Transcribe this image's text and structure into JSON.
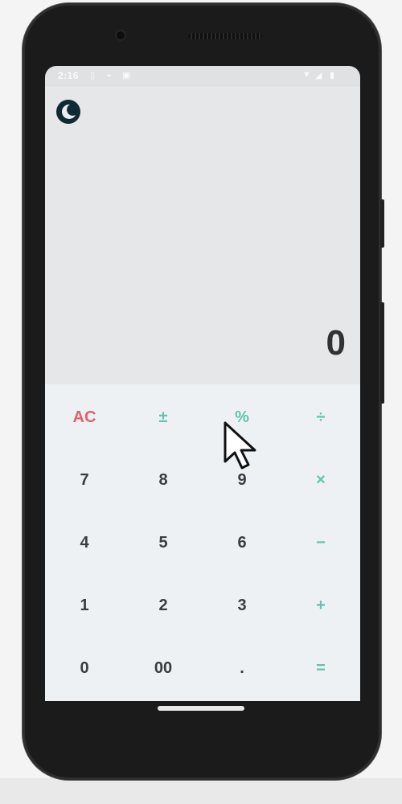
{
  "status_bar": {
    "time": "2:16",
    "icons": [
      "notification-icon",
      "notification-icon",
      "lock-icon",
      "wifi-icon",
      "signal-icon",
      "battery-icon"
    ]
  },
  "display": {
    "theme_toggle_icon": "moon-icon",
    "result": "0"
  },
  "keypad": {
    "rows": [
      [
        "AC",
        "±",
        "%",
        "÷"
      ],
      [
        "7",
        "8",
        "9",
        "×"
      ],
      [
        "4",
        "5",
        "6",
        "−"
      ],
      [
        "1",
        "2",
        "3",
        "+"
      ],
      [
        "0",
        "00",
        ".",
        "="
      ]
    ],
    "key_names": [
      [
        "all-clear-button",
        "plus-minus-button",
        "percent-button",
        "divide-button"
      ],
      [
        "digit-7-button",
        "digit-8-button",
        "digit-9-button",
        "multiply-button"
      ],
      [
        "digit-4-button",
        "digit-5-button",
        "digit-6-button",
        "minus-button"
      ],
      [
        "digit-1-button",
        "digit-2-button",
        "digit-3-button",
        "plus-button"
      ],
      [
        "digit-0-button",
        "double-zero-button",
        "decimal-button",
        "equals-button"
      ]
    ],
    "key_types": [
      [
        "clear",
        "op",
        "op",
        "op"
      ],
      [
        "num",
        "num",
        "num",
        "op"
      ],
      [
        "num",
        "num",
        "num",
        "op"
      ],
      [
        "num",
        "num",
        "num",
        "op"
      ],
      [
        "num",
        "num",
        "num",
        "op"
      ]
    ]
  },
  "colors": {
    "accent": "#5fc4b0",
    "clear": "#e0616a",
    "digit": "#3a3d40",
    "display_background": "#e5e7e9",
    "keypad_background": "#eef1f3"
  }
}
